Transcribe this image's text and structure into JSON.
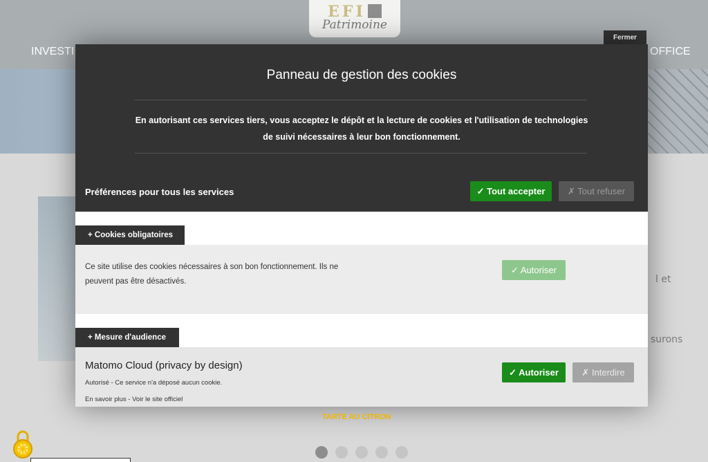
{
  "site": {
    "logo_top": "EFI",
    "logo_bottom": "Patrimoine",
    "nav_left": "INVESTI",
    "nav_right": "OFFICE",
    "bg_text_1": "l et",
    "bg_text_2": "surons",
    "carousel_dots": 5,
    "carousel_active": 1
  },
  "cookie_panel": {
    "close_label": "Fermer",
    "title": "Panneau de gestion des cookies",
    "description": "En autorisant ces services tiers, vous acceptez le dépôt et la lecture de cookies et l'utilisation de technologies de suivi nécessaires à leur bon fonctionnement.",
    "all_services_label": "Préférences pour tous les services",
    "accept_all_label": "✓ Tout accepter",
    "refuse_all_label": "✗ Tout refuser",
    "sections": {
      "required": {
        "title": "+ Cookies obligatoires",
        "text": "Ce site utilise des cookies nécessaires à son bon fonctionnement. Ils ne peuvent pas être désactivés.",
        "allow_label": "✓ Autoriser"
      },
      "audience": {
        "title": "+ Mesure d'audience",
        "service_name": "Matomo Cloud (privacy by design)",
        "status": "Autorisé - Ce service n'a déposé aucun cookie.",
        "link_more": "En savoir plus",
        "link_separator": " - ",
        "link_site": "Voir le site officiel",
        "allow_label": "✓ Autoriser",
        "deny_label": "✗ Interdire"
      }
    },
    "footer_brand": "TARTE AU CITRON"
  },
  "colors": {
    "accept_green": "#1a8c1a",
    "panel_dark": "#333333",
    "brand_yellow": "#f0b600"
  }
}
